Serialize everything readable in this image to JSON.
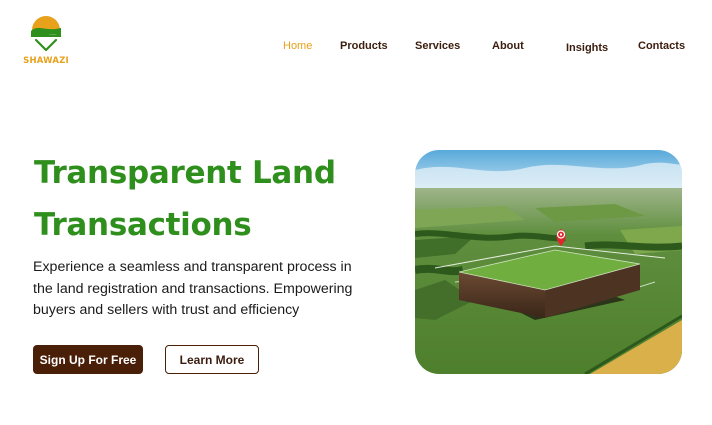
{
  "brand": {
    "name": "SHAWAZI",
    "logo_icon": "sunrise-hills-check-icon",
    "colors": {
      "orange": "#e7a11a",
      "green": "#2f8f1d"
    }
  },
  "nav": {
    "items": [
      {
        "label": "Home",
        "active": true
      },
      {
        "label": "Products",
        "active": false
      },
      {
        "label": "Services",
        "active": false
      },
      {
        "label": "About",
        "active": false
      },
      {
        "label": "Insights",
        "active": false
      },
      {
        "label": "Contacts",
        "active": false
      }
    ]
  },
  "hero": {
    "title_line1": "Transparent Land",
    "title_line2": "Transactions",
    "description_line1": "Experience a seamless and transparent process in",
    "description_line2": "the land registration and transactions. Empowering",
    "description_line3": "buyers and sellers with trust and efficiency",
    "primary_button": "Sign Up For Free",
    "secondary_button": "Learn More",
    "image_icon": "land-parcel-map-pin-image",
    "colors": {
      "title": "#2f8f1d",
      "button_dark": "#4a1f08",
      "pin": "#e0262c"
    }
  }
}
